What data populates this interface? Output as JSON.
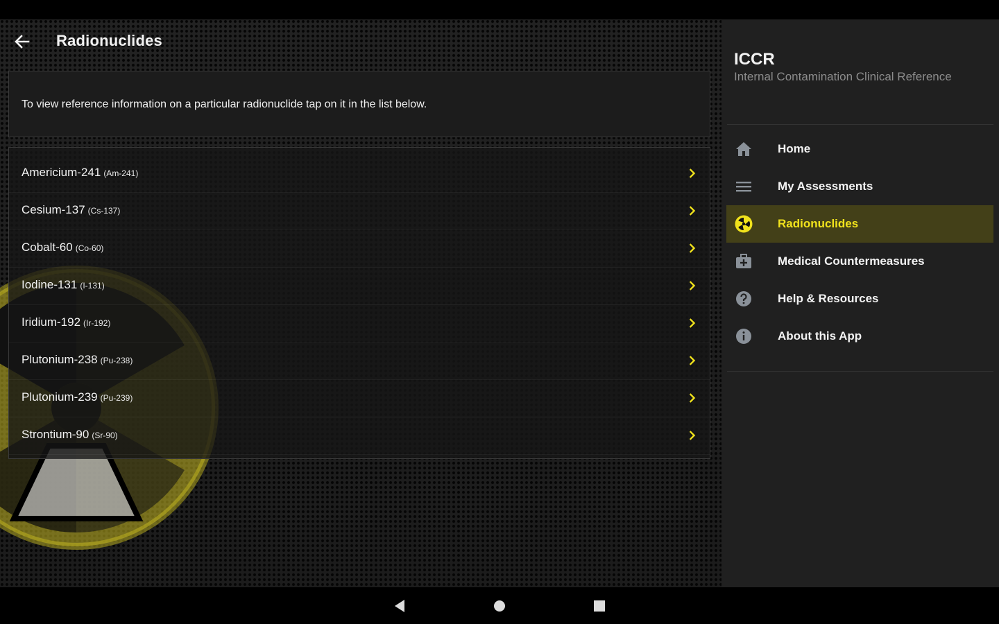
{
  "header": {
    "title": "Radionuclides"
  },
  "intro": {
    "text": "To view reference information on a particular radionuclide tap on it in the list below."
  },
  "radionuclides": [
    {
      "name": "Americium-241",
      "abbr": "(Am-241)"
    },
    {
      "name": "Cesium-137",
      "abbr": "(Cs-137)"
    },
    {
      "name": "Cobalt-60",
      "abbr": "(Co-60)"
    },
    {
      "name": "Iodine-131",
      "abbr": "(I-131)"
    },
    {
      "name": "Iridium-192",
      "abbr": "(Ir-192)"
    },
    {
      "name": "Plutonium-238",
      "abbr": "(Pu-238)"
    },
    {
      "name": "Plutonium-239",
      "abbr": "(Pu-239)"
    },
    {
      "name": "Strontium-90",
      "abbr": "(Sr-90)"
    }
  ],
  "drawer": {
    "title": "ICCR",
    "subtitle": "Internal Contamination Clinical Reference",
    "items": [
      {
        "label": "Home",
        "icon": "home-icon"
      },
      {
        "label": "My Assessments",
        "icon": "list-icon"
      },
      {
        "label": "Radionuclides",
        "icon": "radiation-icon",
        "active": true
      },
      {
        "label": "Medical Countermeasures",
        "icon": "medical-kit-icon"
      },
      {
        "label": "Help & Resources",
        "icon": "help-icon"
      },
      {
        "label": "About this App",
        "icon": "info-icon"
      }
    ]
  },
  "colors": {
    "accent": "#f0e21c",
    "active_bg": "#434018",
    "drawer_bg": "#202020",
    "icon_gray": "#8a9199"
  }
}
